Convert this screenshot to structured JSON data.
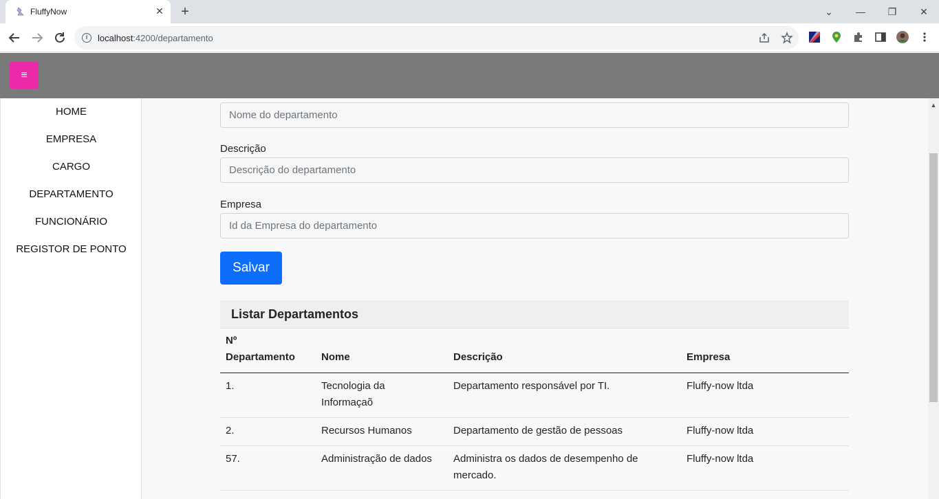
{
  "browser": {
    "tab_title": "FluffyNow",
    "tab_close": "✕",
    "new_tab": "+",
    "url_host": "localhost",
    "url_path": ":4200/departamento",
    "window_controls": {
      "tabsearch": "⌄",
      "minimize": "—",
      "restore": "❐",
      "close": "✕"
    }
  },
  "app": {
    "menu_icon": "≡",
    "accent_color": "#ec2aa9"
  },
  "sidebar": {
    "items": [
      {
        "label": "HOME"
      },
      {
        "label": "EMPRESA"
      },
      {
        "label": "CARGO"
      },
      {
        "label": "DEPARTAMENTO"
      },
      {
        "label": "FUNCIONÁRIO"
      },
      {
        "label": "REGISTOR DE PONTO"
      }
    ]
  },
  "form": {
    "nome_placeholder": "Nome do departamento",
    "descricao_label": "Descrição",
    "descricao_placeholder": "Descrição do departamento",
    "empresa_label": "Empresa",
    "empresa_placeholder": "Id da Empresa do departamento",
    "save_label": "Salvar"
  },
  "list": {
    "title": "Listar Departamentos",
    "columns": {
      "numero_line1": "Nº",
      "numero_line2": "Departamento",
      "nome": "Nome",
      "descricao": "Descrição",
      "empresa": "Empresa"
    },
    "rows": [
      {
        "numero": "1.",
        "nome_line1": "Tecnologia da",
        "nome_line2": "Informaçaõ",
        "descricao_line1": "Departamento responsável por TI.",
        "descricao_line2": "",
        "empresa": "Fluffy-now ltda"
      },
      {
        "numero": "2.",
        "nome_line1": "Recursos Humanos",
        "nome_line2": "",
        "descricao_line1": "Departamento de gestão de pessoas",
        "descricao_line2": "",
        "empresa": "Fluffy-now ltda"
      },
      {
        "numero": "57.",
        "nome_line1": "Administração de dados",
        "nome_line2": "",
        "descricao_line1": "Administra os dados de desempenho de",
        "descricao_line2": "mercado.",
        "empresa": "Fluffy-now ltda"
      }
    ]
  }
}
